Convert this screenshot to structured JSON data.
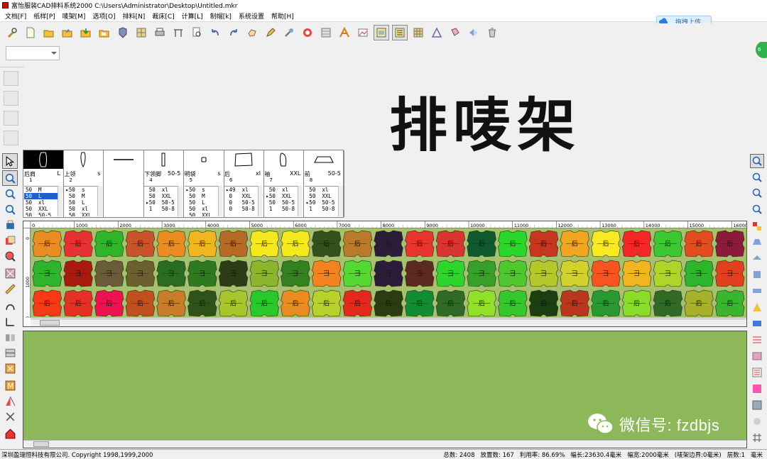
{
  "window": {
    "title": "富怡服装CAD排料系统2000 C:\\Users\\Administrator\\Desktop\\Untitled.mkr"
  },
  "menu": [
    "文档[F]",
    "纸样[P]",
    "唛架[M]",
    "选项[O]",
    "排料[N]",
    "裁床[C]",
    "计算[L]",
    "制帽[k]",
    "系统设置",
    "帮助[H]"
  ],
  "upload_button": {
    "label": "拖拽上传"
  },
  "overlay_title": "排唛架",
  "pieces": [
    {
      "name": "后肩",
      "size": "L",
      "num": "1",
      "selected": true,
      "rows": [
        "50  M",
        "50  L",
        "50  xl",
        "50  XXL",
        "50  50-5"
      ],
      "sel_row": 1
    },
    {
      "name": "上领",
      "size": "s",
      "num": "2",
      "rows": [
        "▸50  s",
        " 50  M",
        " 50  L",
        " 50  xl",
        " 50  XXL"
      ],
      "sel_row": -1
    },
    {
      "name": "",
      "size": "",
      "num": "",
      "rows": [],
      "sel_row": -1
    },
    {
      "name": "下领脚",
      "size": "50-5",
      "num": "4",
      "rows": [
        " 50  xl",
        " 50  XXL",
        "▸50  50-5",
        " 1   50-8"
      ],
      "sel_row": -1
    },
    {
      "name": "明袋",
      "size": "s",
      "num": "5",
      "rows": [
        "▸50  s",
        " 50  M",
        " 50  L",
        " 50  xl",
        " 50  XXL"
      ],
      "sel_row": -1
    },
    {
      "name": "后",
      "size": "xl",
      "num": "6",
      "rows": [
        "▸49  xl",
        " 0   XXL",
        " 0   50-5",
        " 0   50-8"
      ],
      "sel_row": -1
    },
    {
      "name": "袖",
      "size": "XXL",
      "num": "7",
      "rows": [
        " 50  xl",
        "▸50  XXL",
        " 50  50-5",
        " 1   50-8"
      ],
      "sel_row": -1
    },
    {
      "name": "前",
      "size": "50-5",
      "num": "8",
      "rows": [
        " 50  xl",
        " 50  XXL",
        "▸50  50-5",
        " 1   50-8"
      ],
      "sel_row": -1
    }
  ],
  "ruler": {
    "top": [
      "0",
      "1000",
      "2000",
      "3000",
      "4000",
      "5000",
      "6000",
      "7000",
      "8000",
      "9000",
      "10000",
      "11000",
      "12000",
      "13000",
      "14000",
      "15000",
      "16000"
    ],
    "left": [
      "0",
      "1000",
      "2000"
    ]
  },
  "marker": {
    "row_labels": [
      "后",
      "⺕",
      "后"
    ],
    "rows": [
      [
        "#e98d22",
        "#e83131",
        "#2fb52c",
        "#c9532a",
        "#e98d22",
        "#f0b51f",
        "#b56a27",
        "#f5e91d",
        "#f5e91d",
        "#33511b",
        "#b97b2a",
        "#2b1d3a",
        "#e8342f",
        "#d9342f",
        "#0f5a2c",
        "#2ad82b",
        "#c5371f",
        "#f0a620",
        "#f8ea22",
        "#f52626",
        "#3dc732",
        "#e24c1f",
        "#8b1b3b"
      ],
      [
        "#2fb52c",
        "#a8190f",
        "#695c36",
        "#6c602f",
        "#2a6c20",
        "#2f7a1f",
        "#2c3d16",
        "#8ab52c",
        "#33821f",
        "#f2831f",
        "#55d832",
        "#2b1d3a",
        "#5d2a1f",
        "#2fd42c",
        "#37a029",
        "#4fc72f",
        "#b5c82a",
        "#d3d22c",
        "#f7541f",
        "#f0b51f",
        "#aed62a",
        "#2fb52c",
        "#e23f1f"
      ],
      [
        "#f53a15",
        "#e43126",
        "#ea1350",
        "#c0511e",
        "#c77d2a",
        "#2e5217",
        "#a9c52c",
        "#29c82b",
        "#e98d22",
        "#b8d12c",
        "#e2291e",
        "#2b3b12",
        "#138d33",
        "#2f6b27",
        "#93e02a",
        "#35c72d",
        "#1c3f12",
        "#b9371f",
        "#2a9932",
        "#8adb2a",
        "#2f6b27",
        "#a8b12c",
        "#39b52f"
      ]
    ]
  },
  "watermark": {
    "text": "微信号: fzdbjs"
  },
  "status": {
    "company": "深圳盈瑞恒科技有限公司. Copyright 1998,1999,2000",
    "items": [
      "总数: 2408",
      "放置数: 167",
      "利用率: 86.69%",
      "幅长:23630.4毫米",
      "幅宽:2000毫米",
      "(唛架边界:0毫米)",
      "层数:1",
      "毫米"
    ]
  },
  "colors": {
    "marker_bg": "#a7c26d",
    "work_area": "#8cb85a",
    "selection": "#1e60d0"
  }
}
